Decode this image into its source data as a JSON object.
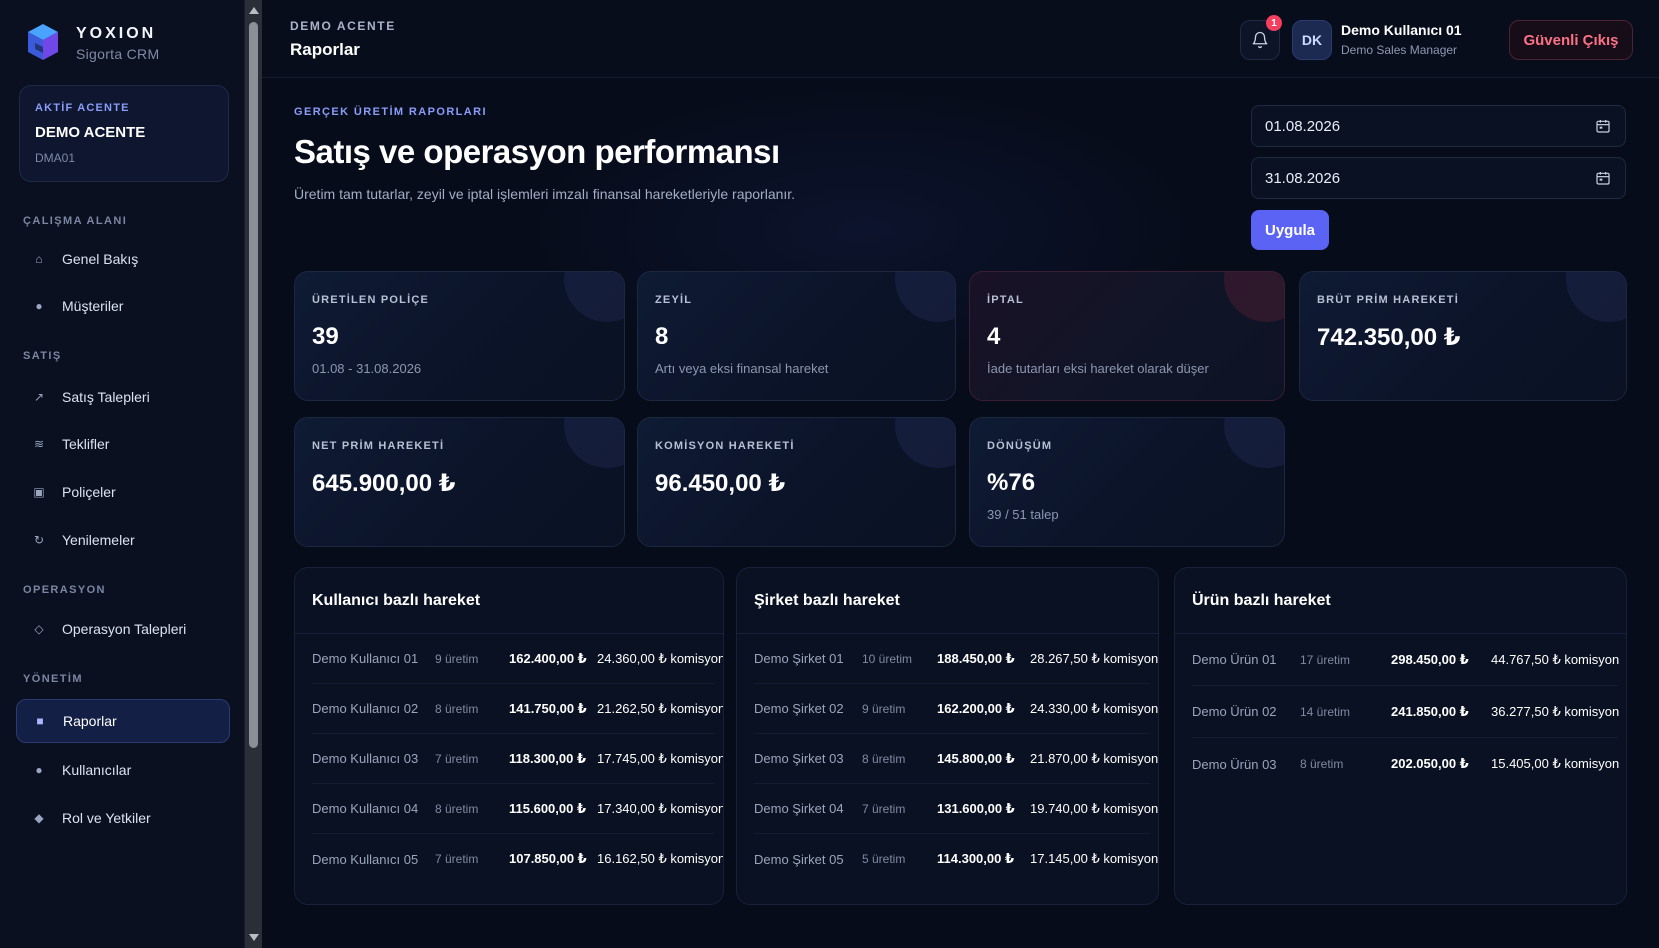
{
  "brand": {
    "name": "YOXION",
    "subtitle": "Sigorta CRM"
  },
  "agency": {
    "label": "AKTİF ACENTE",
    "name": "DEMO ACENTE",
    "code": "DMA01"
  },
  "nav": {
    "sections": {
      "workspace": "ÇALIŞMA ALANI",
      "sales": "SATIŞ",
      "operations": "OPERASYON",
      "management": "YÖNETİM"
    },
    "items": [
      {
        "label": "Genel Bakış",
        "icon": "home-icon"
      },
      {
        "label": "Müşteriler",
        "icon": "users-icon"
      },
      {
        "label": "Satış Talepleri",
        "icon": "trend-icon"
      },
      {
        "label": "Teklifler",
        "icon": "offers-icon"
      },
      {
        "label": "Poliçeler",
        "icon": "policy-icon"
      },
      {
        "label": "Yenilemeler",
        "icon": "refresh-icon"
      },
      {
        "label": "Operasyon Talepleri",
        "icon": "diamond-icon"
      },
      {
        "label": "Raporlar",
        "icon": "reports-icon",
        "active": true
      },
      {
        "label": "Kullanıcılar",
        "icon": "user-icon"
      },
      {
        "label": "Rol ve Yetkiler",
        "icon": "shield-icon"
      }
    ]
  },
  "header": {
    "crumb": "DEMO ACENTE",
    "title": "Raporlar",
    "notifications": "1",
    "avatar": "DK",
    "user_name": "Demo Kullanıcı 01",
    "user_role": "Demo Sales Manager",
    "logout": "Güvenli Çıkış"
  },
  "hero": {
    "eyebrow": "GERÇEK ÜRETİM RAPORLARI",
    "title": "Satış ve operasyon performansı",
    "description": "Üretim tam tutarlar, zeyil ve iptal işlemleri imzalı finansal hareketleriyle raporlanır."
  },
  "filters": {
    "start_date": "01.08.2026",
    "end_date": "31.08.2026",
    "apply": "Uygula"
  },
  "stats": [
    {
      "label": "ÜRETİLEN POLİÇE",
      "value": "39",
      "sub": "01.08 - 31.08.2026"
    },
    {
      "label": "ZEYİL",
      "value": "8",
      "sub": "Artı veya eksi finansal hareket"
    },
    {
      "label": "İPTAL",
      "value": "4",
      "sub": "İade tutarları eksi hareket olarak düşer"
    },
    {
      "label": "BRÜT PRİM HAREKETİ",
      "value": "742.350,00 ₺",
      "sub": ""
    },
    {
      "label": "NET PRİM HAREKETİ",
      "value": "645.900,00 ₺",
      "sub": ""
    },
    {
      "label": "KOMİSYON HAREKETİ",
      "value": "96.450,00 ₺",
      "sub": ""
    },
    {
      "label": "DÖNÜŞÜM",
      "value": "%76",
      "sub": "39 / 51 talep"
    }
  ],
  "panels": {
    "users": {
      "title": "Kullanıcı bazlı hareket",
      "rows": [
        {
          "name": "Demo Kullanıcı 01",
          "count": "9 üretim",
          "amount": "162.400,00 ₺",
          "commission": "24.360,00 ₺ komisyon"
        },
        {
          "name": "Demo Kullanıcı 02",
          "count": "8 üretim",
          "amount": "141.750,00 ₺",
          "commission": "21.262,50 ₺ komisyon"
        },
        {
          "name": "Demo Kullanıcı 03",
          "count": "7 üretim",
          "amount": "118.300,00 ₺",
          "commission": "17.745,00 ₺ komisyon"
        },
        {
          "name": "Demo Kullanıcı 04",
          "count": "8 üretim",
          "amount": "115.600,00 ₺",
          "commission": "17.340,00 ₺ komisyon"
        },
        {
          "name": "Demo Kullanıcı 05",
          "count": "7 üretim",
          "amount": "107.850,00 ₺",
          "commission": "16.162,50 ₺ komisyon"
        }
      ]
    },
    "companies": {
      "title": "Şirket bazlı hareket",
      "rows": [
        {
          "name": "Demo Şirket 01",
          "count": "10 üretim",
          "amount": "188.450,00 ₺",
          "commission": "28.267,50 ₺ komisyon"
        },
        {
          "name": "Demo Şirket 02",
          "count": "9 üretim",
          "amount": "162.200,00 ₺",
          "commission": "24.330,00 ₺ komisyon"
        },
        {
          "name": "Demo Şirket 03",
          "count": "8 üretim",
          "amount": "145.800,00 ₺",
          "commission": "21.870,00 ₺ komisyon"
        },
        {
          "name": "Demo Şirket 04",
          "count": "7 üretim",
          "amount": "131.600,00 ₺",
          "commission": "19.740,00 ₺ komisyon"
        },
        {
          "name": "Demo Şirket 05",
          "count": "5 üretim",
          "amount": "114.300,00 ₺",
          "commission": "17.145,00 ₺ komisyon"
        }
      ]
    },
    "products": {
      "title": "Ürün bazlı hareket",
      "rows": [
        {
          "name": "Demo Ürün 01",
          "count": "17 üretim",
          "amount": "298.450,00 ₺",
          "commission": "44.767,50 ₺ komisyon"
        },
        {
          "name": "Demo Ürün 02",
          "count": "14 üretim",
          "amount": "241.850,00 ₺",
          "commission": "36.277,50 ₺ komisyon"
        },
        {
          "name": "Demo Ürün 03",
          "count": "8 üretim",
          "amount": "202.050,00 ₺",
          "commission": "15.405,00 ₺ komisyon"
        }
      ]
    }
  },
  "colors": {
    "accent": "#5b63f5",
    "accent_text": "#8b9cf9",
    "danger": "#fb7185",
    "background": "#070c1a"
  }
}
